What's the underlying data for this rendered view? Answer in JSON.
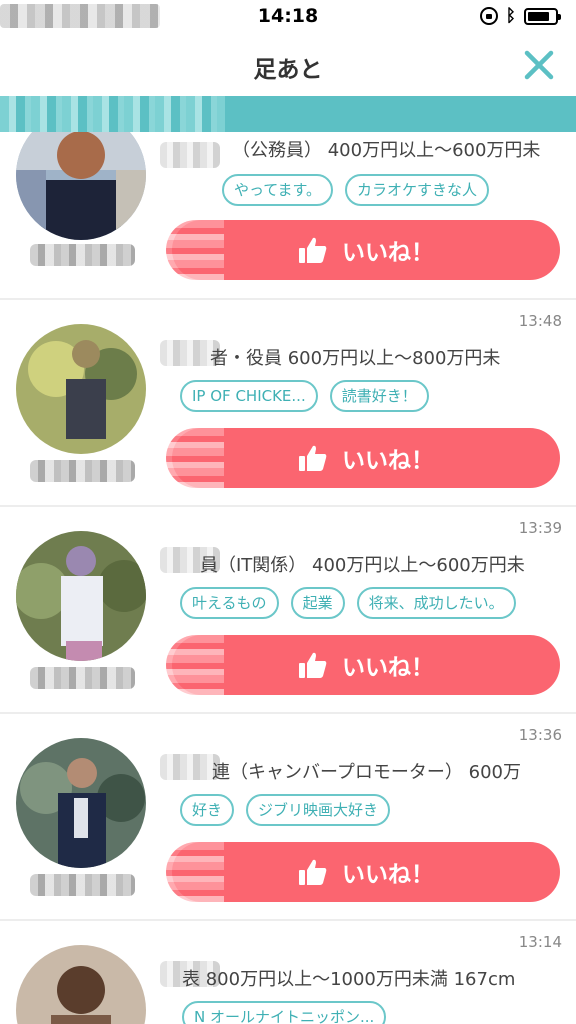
{
  "status_bar": {
    "time": "14:18"
  },
  "nav": {
    "title": "足あと"
  },
  "colors": {
    "accent_teal": "#5cc0c4",
    "like_red": "#fb6570"
  },
  "icons": {
    "close": "close-icon",
    "like": "thumbs-up-icon"
  },
  "like_label": "いいね！",
  "items": [
    {
      "time": "",
      "info": "（公務員） 400万円以上〜600万円未",
      "tags": [
        "やってます。",
        "カラオケすきな人"
      ],
      "like": "いいね！"
    },
    {
      "time": "13:48",
      "info": "者・役員 600万円以上〜800万円未",
      "tags": [
        "IP OF CHICKE...",
        "読書好き！"
      ],
      "like": "いいね！"
    },
    {
      "time": "13:39",
      "info": "員（IT関係） 400万円以上〜600万円未",
      "tags": [
        "叶えるもの",
        "起業",
        "将来、成功したい。"
      ],
      "like": "いいね！"
    },
    {
      "time": "13:36",
      "info": "連（キャンバープロモーター） 600万",
      "tags": [
        "好き",
        "ジブリ映画大好き"
      ],
      "like": "いいね！"
    },
    {
      "time": "13:14",
      "info": "表 800万円以上〜1000万円未満 167cm",
      "tags": [
        "N オールナイトニッポン..."
      ],
      "like": ""
    }
  ]
}
